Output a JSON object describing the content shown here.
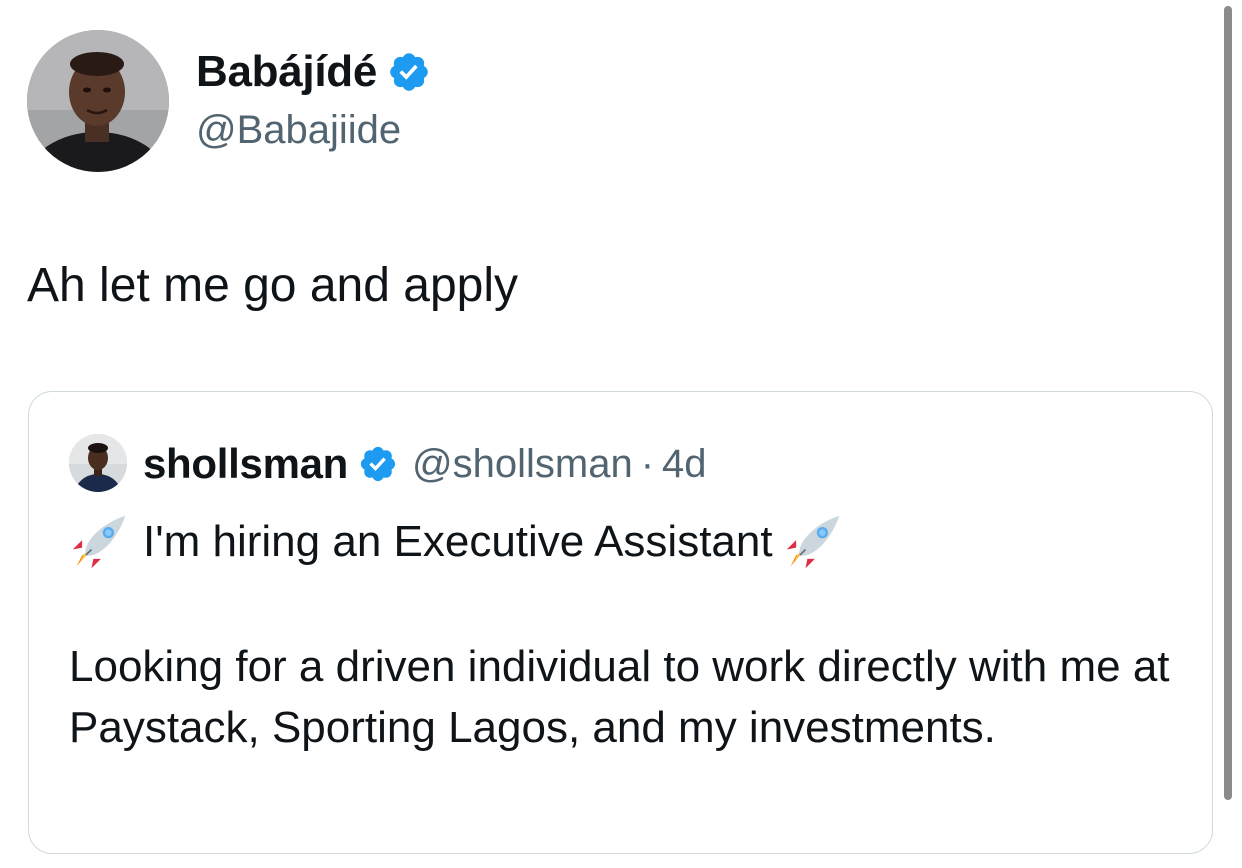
{
  "author": {
    "name": "Babájídé",
    "handle": "@Babajiide",
    "verified": true
  },
  "tweet": {
    "text": "Ah let me go and apply"
  },
  "quoted_tweet": {
    "name": "shollsman",
    "verified": true,
    "handle": "@shollsman",
    "separator": "·",
    "time": "4d",
    "headline": "I'm hiring an Executive Assistant",
    "headline_icons": [
      "rocket-icon",
      "rocket-icon"
    ],
    "body": "Looking for a driven individual to work directly with me at Paystack, Sporting Lagos, and my investments."
  },
  "colors": {
    "verified_blue": "#1d9bf0",
    "secondary_text": "#536471",
    "border": "#cfd9de"
  }
}
